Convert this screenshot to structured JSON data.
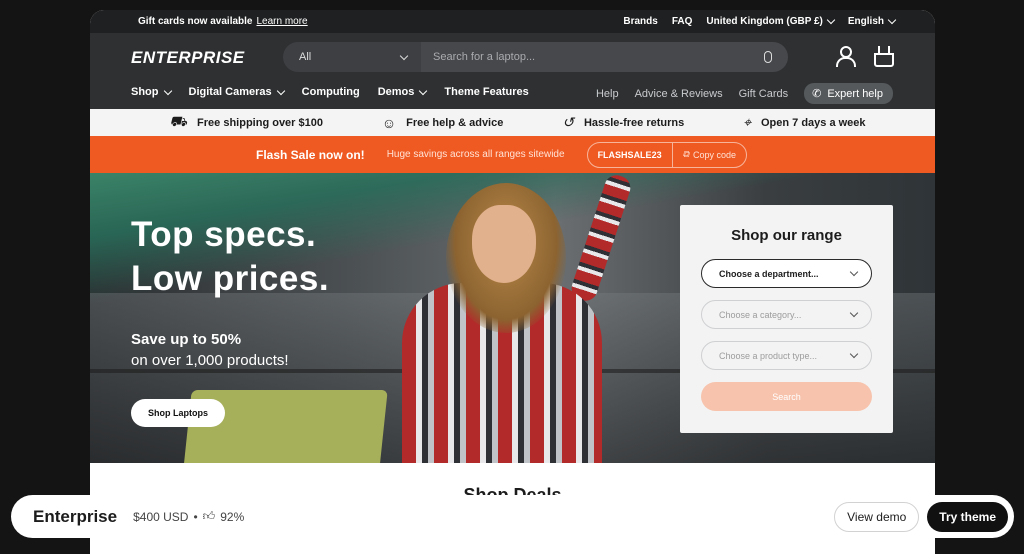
{
  "announcement": {
    "text": "Gift cards now available",
    "link": "Learn more",
    "brands": "Brands",
    "faq": "FAQ",
    "country": "United Kingdom (GBP £)",
    "language": "English"
  },
  "header": {
    "logo": "ENTERPRISE",
    "search_dept": "All",
    "search_placeholder": "Search for a laptop...",
    "nav": [
      "Shop",
      "Digital Cameras",
      "Computing",
      "Demos",
      "Theme Features"
    ],
    "nav_right": [
      "Help",
      "Advice & Reviews",
      "Gift Cards"
    ],
    "expert_help": "Expert help"
  },
  "usp": [
    {
      "icon": "truck-icon",
      "glyph": "⛟",
      "text": "Free shipping over $100"
    },
    {
      "icon": "chat-icon",
      "glyph": "☺",
      "text": "Free help & advice"
    },
    {
      "icon": "return-icon",
      "glyph": "↺",
      "text": "Hassle-free returns"
    },
    {
      "icon": "location-icon",
      "glyph": "⌖",
      "text": "Open 7 days a week"
    }
  ],
  "flash": {
    "title": "Flash Sale now on!",
    "subtitle": "Huge savings across all ranges sitewide",
    "code": "FLASHSALE23",
    "copy": "Copy code"
  },
  "hero": {
    "line1": "Top specs.",
    "line2": "Low prices.",
    "save": "Save up to 50%",
    "sub": "on over 1,000 products!",
    "button": "Shop Laptops"
  },
  "range": {
    "title": "Shop our range",
    "department": "Choose a department...",
    "category": "Choose a category...",
    "product_type": "Choose a product type...",
    "search": "Search"
  },
  "deals_title": "Shop Deals",
  "theme_bar": {
    "name": "Enterprise",
    "price": "$400 USD",
    "rating": "92%",
    "view_demo": "View demo",
    "try_theme": "Try theme"
  },
  "colors": {
    "accent": "#ef5a22",
    "header_bg": "#2e3032",
    "search_button_bg": "#f7c3ac"
  }
}
